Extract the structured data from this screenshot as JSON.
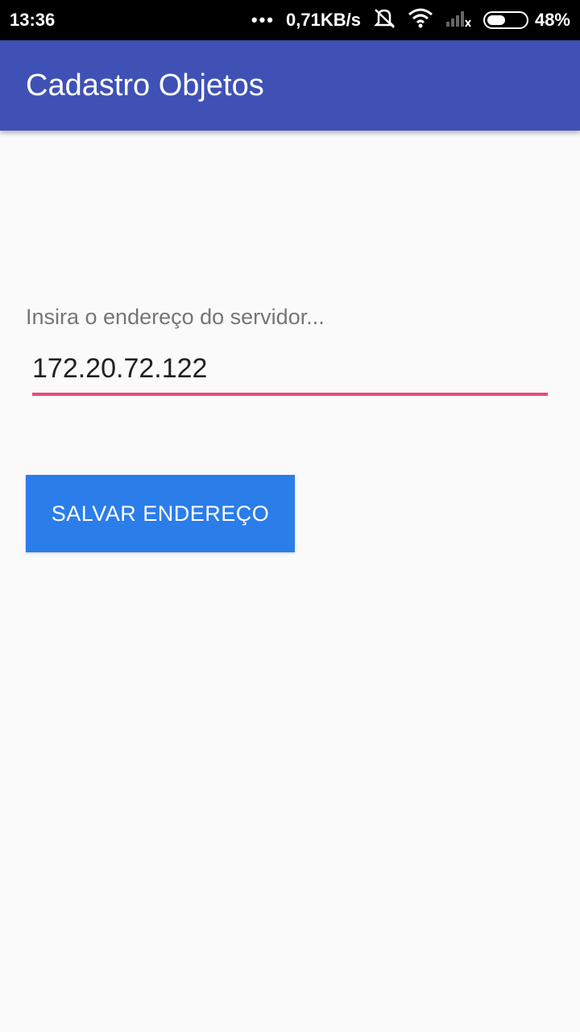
{
  "status_bar": {
    "time": "13:36",
    "more_indicator": "•••",
    "network_speed": "0,71KB/s",
    "battery_percent": "48%",
    "battery_level": 0.48,
    "icons": [
      "mute-icon",
      "wifi-icon",
      "signal-icon",
      "battery-icon"
    ]
  },
  "app_bar": {
    "title": "Cadastro Objetos",
    "color": "#3f51b5"
  },
  "form": {
    "server_field": {
      "label": "Insira o endereço do servidor...",
      "value": "172.20.72.122",
      "underline_color": "#e84a82"
    },
    "save_button": {
      "label": "SALVAR ENDEREÇO",
      "color": "#2b7de9"
    }
  }
}
